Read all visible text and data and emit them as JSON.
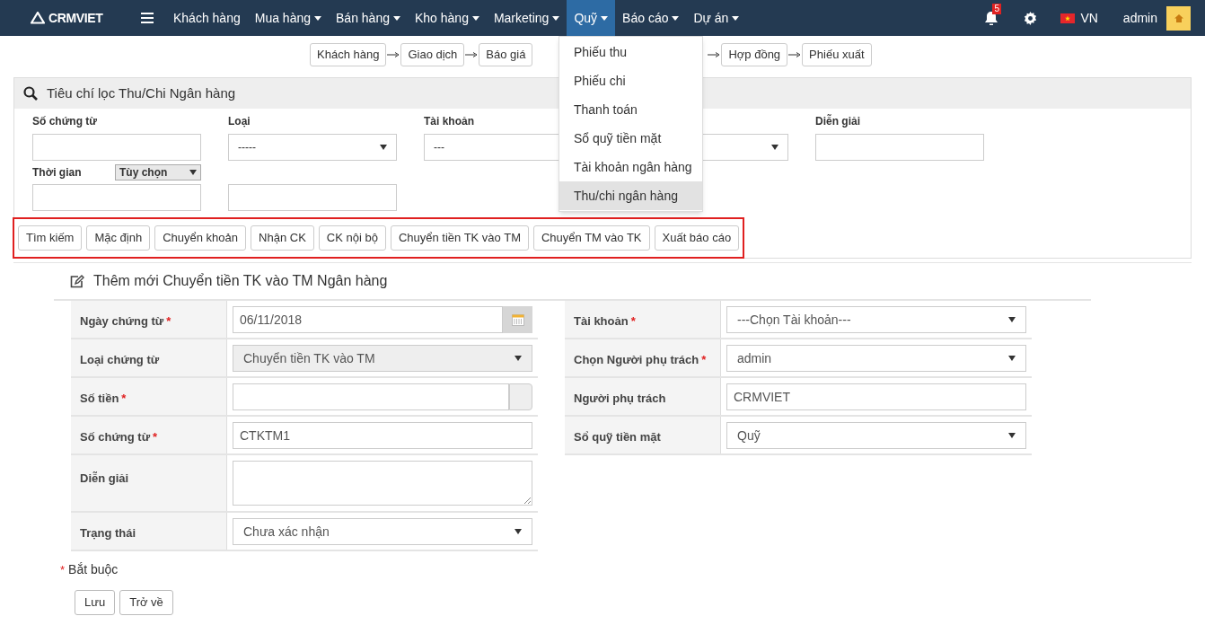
{
  "nav": {
    "logo": "CRMVIET",
    "menu": [
      {
        "label": "Khách hàng",
        "caret": false,
        "selected": false
      },
      {
        "label": "Mua hàng",
        "caret": true,
        "selected": false
      },
      {
        "label": "Bán hàng",
        "caret": true,
        "selected": false
      },
      {
        "label": "Kho hàng",
        "caret": true,
        "selected": false
      },
      {
        "label": "Marketing",
        "caret": true,
        "selected": false
      },
      {
        "label": "Quỹ",
        "caret": true,
        "selected": true
      },
      {
        "label": "Báo cáo",
        "caret": true,
        "selected": false
      },
      {
        "label": "Dự án",
        "caret": true,
        "selected": false
      }
    ],
    "notification_count": "5",
    "language": "VN",
    "user": "admin"
  },
  "dropdown": {
    "items": [
      {
        "label": "Phiếu thu",
        "selected": false
      },
      {
        "label": "Phiếu chi",
        "selected": false
      },
      {
        "label": "Thanh toán",
        "selected": false
      },
      {
        "label": "Sổ quỹ tiền mặt",
        "selected": false
      },
      {
        "label": "Tài khoản ngân hàng",
        "selected": false
      },
      {
        "label": "Thu/chi ngân hàng",
        "selected": true
      }
    ]
  },
  "workflow": {
    "left": [
      "Khách hàng",
      "Giao dịch",
      "Báo giá"
    ],
    "right": [
      "Hợp đồng",
      "Phiếu xuất"
    ]
  },
  "filter": {
    "title": "Tiêu chí lọc Thu/Chi Ngân hàng",
    "fields": [
      {
        "label": "Số chứng từ",
        "kind": "input"
      },
      {
        "label": "Loại",
        "kind": "select",
        "value": "-----"
      },
      {
        "label": "Tài khoản",
        "kind": "covered_select",
        "value": "---"
      },
      {
        "kind": "select"
      },
      {
        "label": "Diễn giải",
        "kind": "input"
      }
    ],
    "time": {
      "label": "Thời gian",
      "option": "Tùy chọn"
    },
    "buttons": [
      "Tìm kiếm",
      "Mặc định",
      "Chuyển khoản",
      "Nhận CK",
      "CK nội bộ",
      "Chuyển tiền TK vào TM",
      "Chuyển TM vào TK",
      "Xuất báo cáo"
    ]
  },
  "form": {
    "title": "Thêm mới Chuyển tiền TK vào TM Ngân hàng",
    "left": [
      {
        "label": "Ngày chứng từ",
        "required": true,
        "kind": "date",
        "value": "06/11/2018"
      },
      {
        "label": "Loại chứng từ",
        "required": false,
        "kind": "select",
        "value": "Chuyển tiền TK vào TM",
        "disabled": true
      },
      {
        "label": "Số tiền",
        "required": true,
        "kind": "money"
      },
      {
        "label": "Số chứng từ",
        "required": true,
        "kind": "text",
        "value": "CTKTM1"
      },
      {
        "label": "Diễn giải",
        "required": false,
        "kind": "textarea"
      },
      {
        "label": "Trạng thái",
        "required": false,
        "kind": "select",
        "value": "Chưa xác nhận",
        "disabled": false
      }
    ],
    "right": [
      {
        "label": "Tài khoản",
        "required": true,
        "kind": "select",
        "value": "---Chọn Tài khoản---",
        "disabled": false
      },
      {
        "label": "Chọn Người phụ trách",
        "required": true,
        "kind": "select",
        "value": "admin",
        "disabled": false
      },
      {
        "label": "Người phụ trách",
        "required": false,
        "kind": "text",
        "value": "CRMVIET"
      },
      {
        "label": "Sổ quỹ tiền mặt",
        "required": false,
        "kind": "select",
        "value": "Quỹ",
        "disabled": false
      }
    ],
    "required_mark": "*",
    "required_note": "Bắt buộc",
    "actions": [
      "Lưu",
      "Trở về"
    ]
  }
}
